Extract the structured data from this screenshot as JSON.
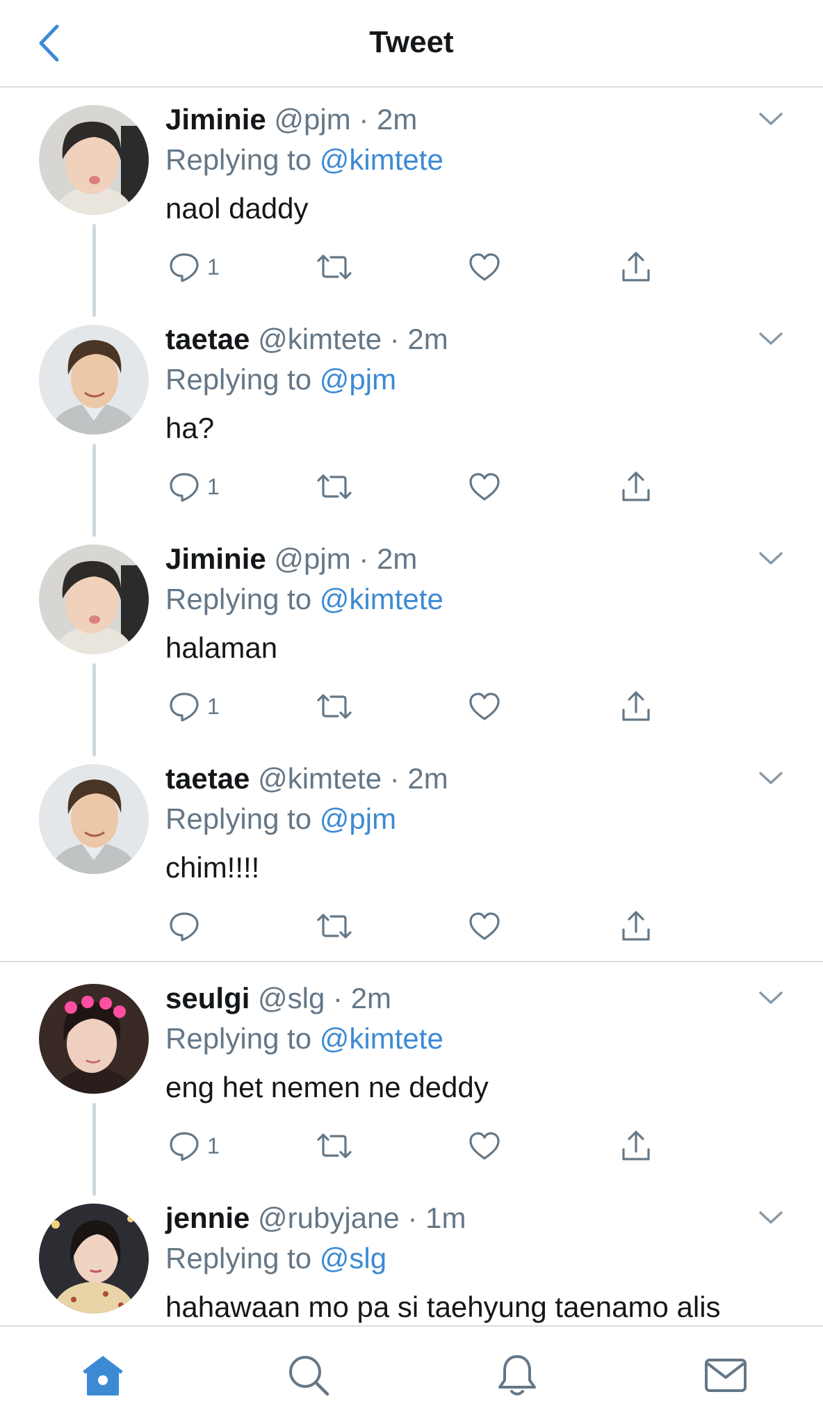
{
  "header": {
    "title": "Tweet",
    "back_icon": "chevron-left-icon",
    "accent_color": "#3d8ad4"
  },
  "tweets": [
    {
      "name": "Jiminie",
      "meta": "@pjm · 2m",
      "reply_prefix": "Replying to ",
      "reply_handle": "@kimtete",
      "text": "naol daddy",
      "reply_count": "1"
    },
    {
      "name": "taetae",
      "meta": "@kimtete · 2m",
      "reply_prefix": "Replying to ",
      "reply_handle": "@pjm",
      "text": "ha?",
      "reply_count": "1"
    },
    {
      "name": "Jiminie",
      "meta": "@pjm · 2m",
      "reply_prefix": "Replying to ",
      "reply_handle": "@kimtete",
      "text": "halaman",
      "reply_count": "1"
    },
    {
      "name": "taetae",
      "meta": "@kimtete · 2m",
      "reply_prefix": "Replying to ",
      "reply_handle": "@pjm",
      "text": "chim!!!!",
      "reply_count": ""
    },
    {
      "name": "seulgi",
      "meta": "@slg · 2m",
      "reply_prefix": "Replying to ",
      "reply_handle": "@kimtete",
      "text": "eng het nemen ne deddy",
      "reply_count": "1"
    },
    {
      "name": "jennie",
      "meta": "@rubyjane · 1m",
      "reply_prefix": "Replying to ",
      "reply_handle": "@slg",
      "text": "hahawaan mo pa si taehyung taenamo alis",
      "reply_count": ""
    }
  ],
  "icons": {
    "reply": "speech-bubble-icon",
    "retweet": "retweet-icon",
    "like": "heart-icon",
    "share": "share-icon",
    "more": "chevron-down-icon"
  },
  "tabbar": {
    "items": [
      "home-icon",
      "search-icon",
      "bell-icon",
      "mail-icon"
    ],
    "active_color": "#3d8ad4",
    "inactive_color": "#657786"
  }
}
